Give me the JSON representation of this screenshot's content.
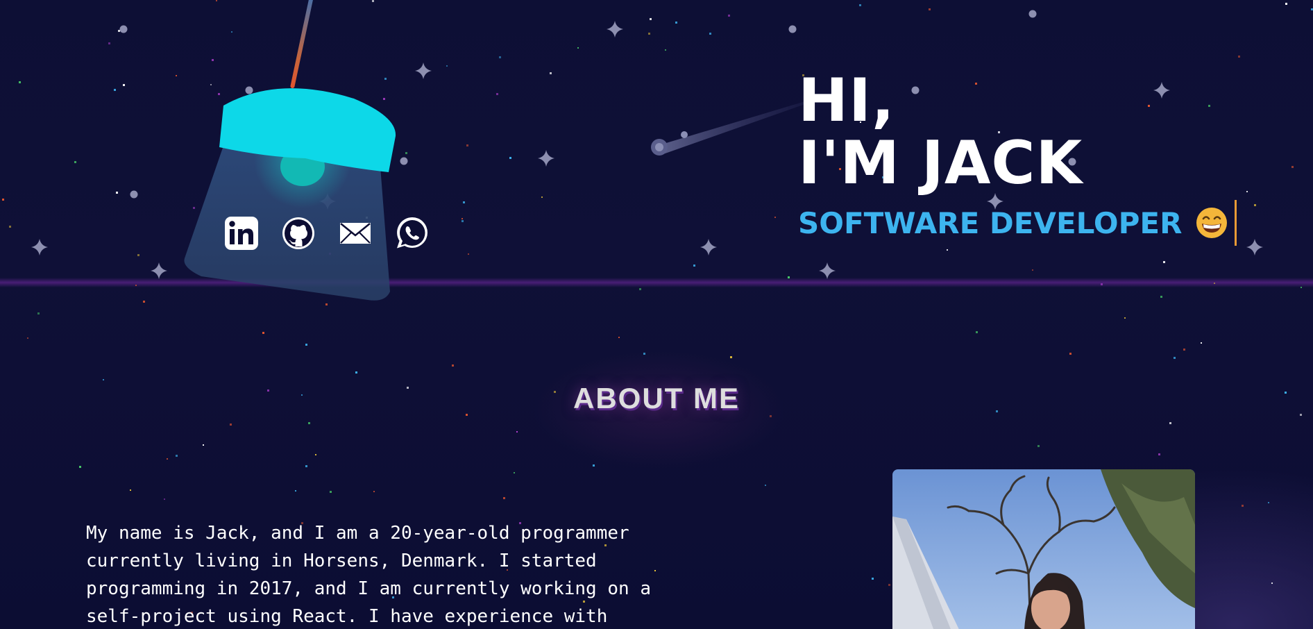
{
  "hero": {
    "line1": "HI,",
    "line2": "I'M JACK",
    "role": "SOFTWARE DEVELOPER"
  },
  "social": [
    {
      "name": "linkedin-icon"
    },
    {
      "name": "github-icon"
    },
    {
      "name": "email-icon"
    },
    {
      "name": "whatsapp-icon"
    }
  ],
  "about": {
    "title": "ABOUT ME",
    "text": "My name is Jack, and I am a 20-year-old programmer currently living in Horsens, Denmark. I started programming in 2017, and I am currently working on a self-project using React. I have experience with"
  },
  "colors": {
    "background": "#0c0d33",
    "accent": "#3db4ef",
    "lamp": "#0dd8e8",
    "caret": "#e89a35"
  }
}
